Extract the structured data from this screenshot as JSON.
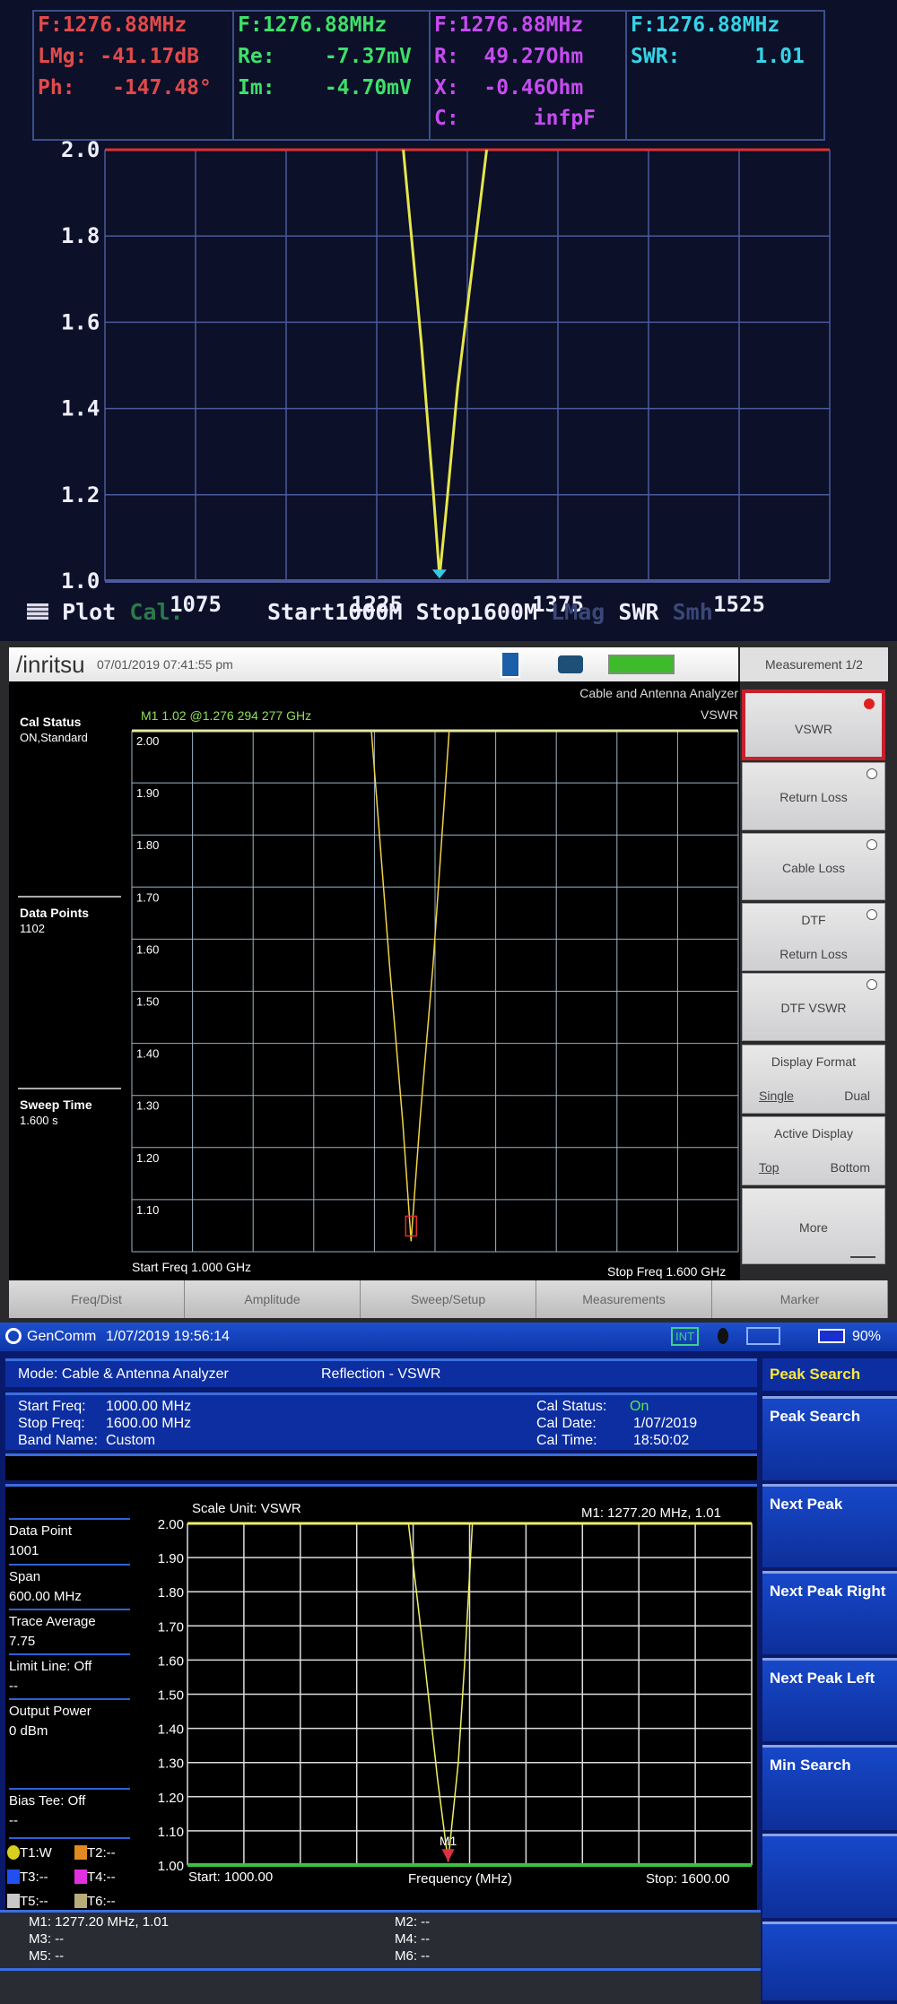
{
  "panel1": {
    "columns": [
      {
        "f": "F:1276.88MHz",
        "rows": [
          "LMg: -41.17dB",
          "Ph:   -147.48°"
        ],
        "color": "#e24a4a"
      },
      {
        "f": "F:1276.88MHz",
        "rows": [
          "Re:    -7.37mV",
          "Im:    -4.70mV"
        ],
        "color": "#3ee06a"
      },
      {
        "f": "F:1276.88MHz",
        "rows": [
          "R:  49.27Ohm",
          "X:  -0.46Ohm",
          "C:      infpF"
        ],
        "color": "#c64bf0"
      },
      {
        "f": "F:1276.88MHz",
        "rows": [
          "SWR:      1.01"
        ],
        "color": "#36d3e6"
      }
    ],
    "bottom": {
      "plot": "Plot",
      "cal": "Cal.",
      "start": "Start1000M",
      "stop": "Stop1600M",
      "lmag": "LMag",
      "swr": "SWR",
      "smh": "Smh"
    }
  },
  "panel2": {
    "brand": "/inritsu",
    "datetime": "07/01/2019 07:41:55 pm",
    "menu_title": "Measurement 1/2",
    "mode": "Cable and Antenna Analyzer",
    "measurement": "VSWR",
    "marker": "M1 1.02 @1.276 294 277 GHz",
    "side": {
      "cal_label": "Cal Status",
      "cal_value": "ON,Standard",
      "dp_label": "Data Points",
      "dp_value": "1102",
      "sweep_label": "Sweep Time",
      "sweep_value": "1.600 s"
    },
    "start": "Start Freq 1.000 GHz",
    "stop": "Stop Freq 1.600 GHz",
    "menu": [
      {
        "label": "VSWR",
        "selected": true
      },
      {
        "label": "Return Loss"
      },
      {
        "label": "Cable Loss"
      },
      {
        "label": "DTF",
        "sub": "Return Loss"
      },
      {
        "label": "DTF VSWR"
      },
      {
        "label": "Display Format",
        "opt1": "Single",
        "opt2": "Dual"
      },
      {
        "label": "Active Display",
        "opt1": "Top",
        "opt2": "Bottom"
      },
      {
        "label": "More"
      }
    ],
    "tabs": [
      "Freq/Dist",
      "Amplitude",
      "Sweep/Setup",
      "Measurements",
      "Marker"
    ]
  },
  "panel3": {
    "brand": "GenComm",
    "datetime": "1/07/2019 19:56:14",
    "int": "INT",
    "battery": "90%",
    "mode": "Mode: Cable & Antenna Analyzer",
    "measurement": "Reflection - VSWR",
    "info": {
      "start_l": "Start Freq:",
      "start_v": "1000.00 MHz",
      "stop_l": "Stop Freq:",
      "stop_v": "1600.00 MHz",
      "band_l": "Band Name:",
      "band_v": "Custom",
      "cal_l": "Cal Status:",
      "cal_v": "On",
      "date_l": "Cal Date:",
      "date_v": "1/07/2019",
      "time_l": "Cal Time:",
      "time_v": "18:50:02"
    },
    "left": [
      [
        "Data Point",
        "1001"
      ],
      [
        "Span",
        "600.00 MHz"
      ],
      [
        "Trace Average",
        "7.75"
      ],
      [
        "Limit Line: Off",
        "--"
      ],
      [
        "Output Power",
        "0 dBm"
      ],
      [
        "Bias Tee: Off",
        "--"
      ]
    ],
    "traces": [
      {
        "l": "T1:W",
        "c": "#d8d020"
      },
      {
        "l": "T2:--",
        "c": "#e08a20"
      },
      {
        "l": "T3:--",
        "c": "#2050f0"
      },
      {
        "l": "T4:--",
        "c": "#e030e0"
      },
      {
        "l": "T5:--",
        "c": "#c8c8c8"
      },
      {
        "l": "T6:--",
        "c": "#b8ac7a"
      }
    ],
    "scale_unit": "Scale Unit: VSWR",
    "marker_readout": "M1: 1277.20 MHz, 1.01",
    "marker_label": "M1",
    "start": "Start: 1000.00",
    "xlabel": "Frequency (MHz)",
    "stop": "Stop: 1600.00",
    "markers": [
      "M1: 1277.20 MHz, 1.01",
      "M2: --",
      "M3: --",
      "M4: --",
      "M5: --",
      "M6: --"
    ],
    "menu_title": "Peak Search",
    "menu": [
      "Peak Search",
      "Next Peak",
      "Next Peak Right",
      "Next Peak Left",
      "Min Search"
    ]
  },
  "chart_data": [
    {
      "type": "line",
      "title": "SWR plot (handheld VNA)",
      "xlabel": "",
      "ylabel": "SWR",
      "xlim": [
        1000,
        1600
      ],
      "ylim": [
        1.0,
        2.0
      ],
      "xticks": [
        1075,
        1225,
        1375,
        1525
      ],
      "yticks": [
        "2.0",
        "1.8",
        "1.6",
        "1.4",
        "1.2",
        "1.0"
      ],
      "grid": true,
      "series": [
        {
          "name": "SWR",
          "color": "#e6e64a",
          "x": [
            1247,
            1262,
            1272,
            1277,
            1282,
            1292,
            1316
          ],
          "y": [
            2.0,
            1.55,
            1.2,
            1.01,
            1.15,
            1.45,
            2.0
          ]
        }
      ],
      "marker": {
        "x": 1276.88,
        "y": 1.01
      }
    },
    {
      "type": "line",
      "title": "VSWR",
      "xlabel": "",
      "ylabel": "VSWR",
      "xlim": [
        1000,
        1600
      ],
      "ylim": [
        1.0,
        2.0
      ],
      "yticks": [
        "2.00",
        "1.90",
        "1.80",
        "1.70",
        "1.60",
        "1.50",
        "1.40",
        "1.30",
        "1.20",
        "1.10"
      ],
      "grid": true,
      "series": [
        {
          "name": "VSWR",
          "color": "#f2d24a",
          "x": [
            1237,
            1255,
            1268,
            1276.3,
            1285,
            1298,
            1314
          ],
          "y": [
            2.0,
            1.55,
            1.25,
            1.02,
            1.25,
            1.55,
            2.0
          ]
        }
      ],
      "marker": {
        "label": "M1",
        "x": 1276.294,
        "y": 1.02
      }
    },
    {
      "type": "line",
      "title": "Reflection - VSWR",
      "xlabel": "Frequency (MHz)",
      "ylabel": "VSWR",
      "xlim": [
        1000,
        1600
      ],
      "ylim": [
        1.0,
        2.0
      ],
      "yticks": [
        "2.00",
        "1.90",
        "1.80",
        "1.70",
        "1.60",
        "1.50",
        "1.40",
        "1.30",
        "1.20",
        "1.10",
        "1.00"
      ],
      "grid": true,
      "series": [
        {
          "name": "T1",
          "color": "#f0f060",
          "x": [
            1235,
            1252,
            1266,
            1277.2,
            1288,
            1295,
            1303
          ],
          "y": [
            2.0,
            1.6,
            1.25,
            1.01,
            1.3,
            1.6,
            2.0
          ]
        }
      ],
      "marker": {
        "label": "M1",
        "x": 1277.2,
        "y": 1.01
      }
    }
  ]
}
